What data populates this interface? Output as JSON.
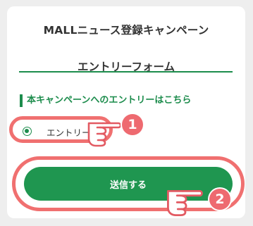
{
  "header": {
    "title": "MALLニュース登録キャンペーン",
    "form_title": "エントリーフォーム"
  },
  "section": {
    "heading": "本キャンペーンへのエントリーはこちら"
  },
  "radio": {
    "label": "エントリー",
    "selected": true
  },
  "submit": {
    "label": "送信する"
  },
  "annotations": {
    "step1": "1",
    "step2": "2",
    "highlight_color": "#f07070",
    "badge_color": "#ee6a70"
  },
  "colors": {
    "accent": "#1c8c4c",
    "button": "#1f9650",
    "background": "#eeeeee",
    "card": "#ffffff"
  }
}
